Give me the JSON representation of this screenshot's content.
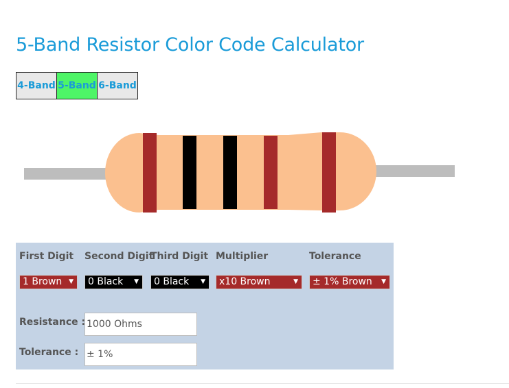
{
  "title": "5-Band Resistor Color Code Calculator",
  "tabs": [
    {
      "label": "4-Band",
      "active": false
    },
    {
      "label": "5-Band",
      "active": true
    },
    {
      "label": "6-Band",
      "active": false
    }
  ],
  "resistor": {
    "body_color": "#fbc08f",
    "lead_color": "#bdbdbd",
    "band_colors": [
      "#a52a2a",
      "#000000",
      "#000000",
      "#a52a2a",
      "#a52a2a"
    ]
  },
  "calculator": {
    "first_digit": {
      "label": "First Digit",
      "value": "1 Brown",
      "color": "#a52a2a"
    },
    "second_digit": {
      "label": "Second Digit",
      "value": "0 Black",
      "color": "#000000"
    },
    "third_digit": {
      "label": "Third Digit",
      "value": "0 Black",
      "color": "#000000"
    },
    "multiplier": {
      "label": "Multiplier",
      "value": "x10 Brown",
      "color": "#a52a2a"
    },
    "tolerance": {
      "label": "Tolerance",
      "value": "± 1% Brown",
      "color": "#a52a2a"
    },
    "resistance_label": "Resistance :",
    "resistance_value": "1000 Ohms",
    "tolerance_label": "Tolerance :",
    "tolerance_value": "± 1%"
  },
  "colors": {
    "accent": "#1a9bd8",
    "active_tab": "#4ef567",
    "panel_bg": "#c4d3e5"
  }
}
